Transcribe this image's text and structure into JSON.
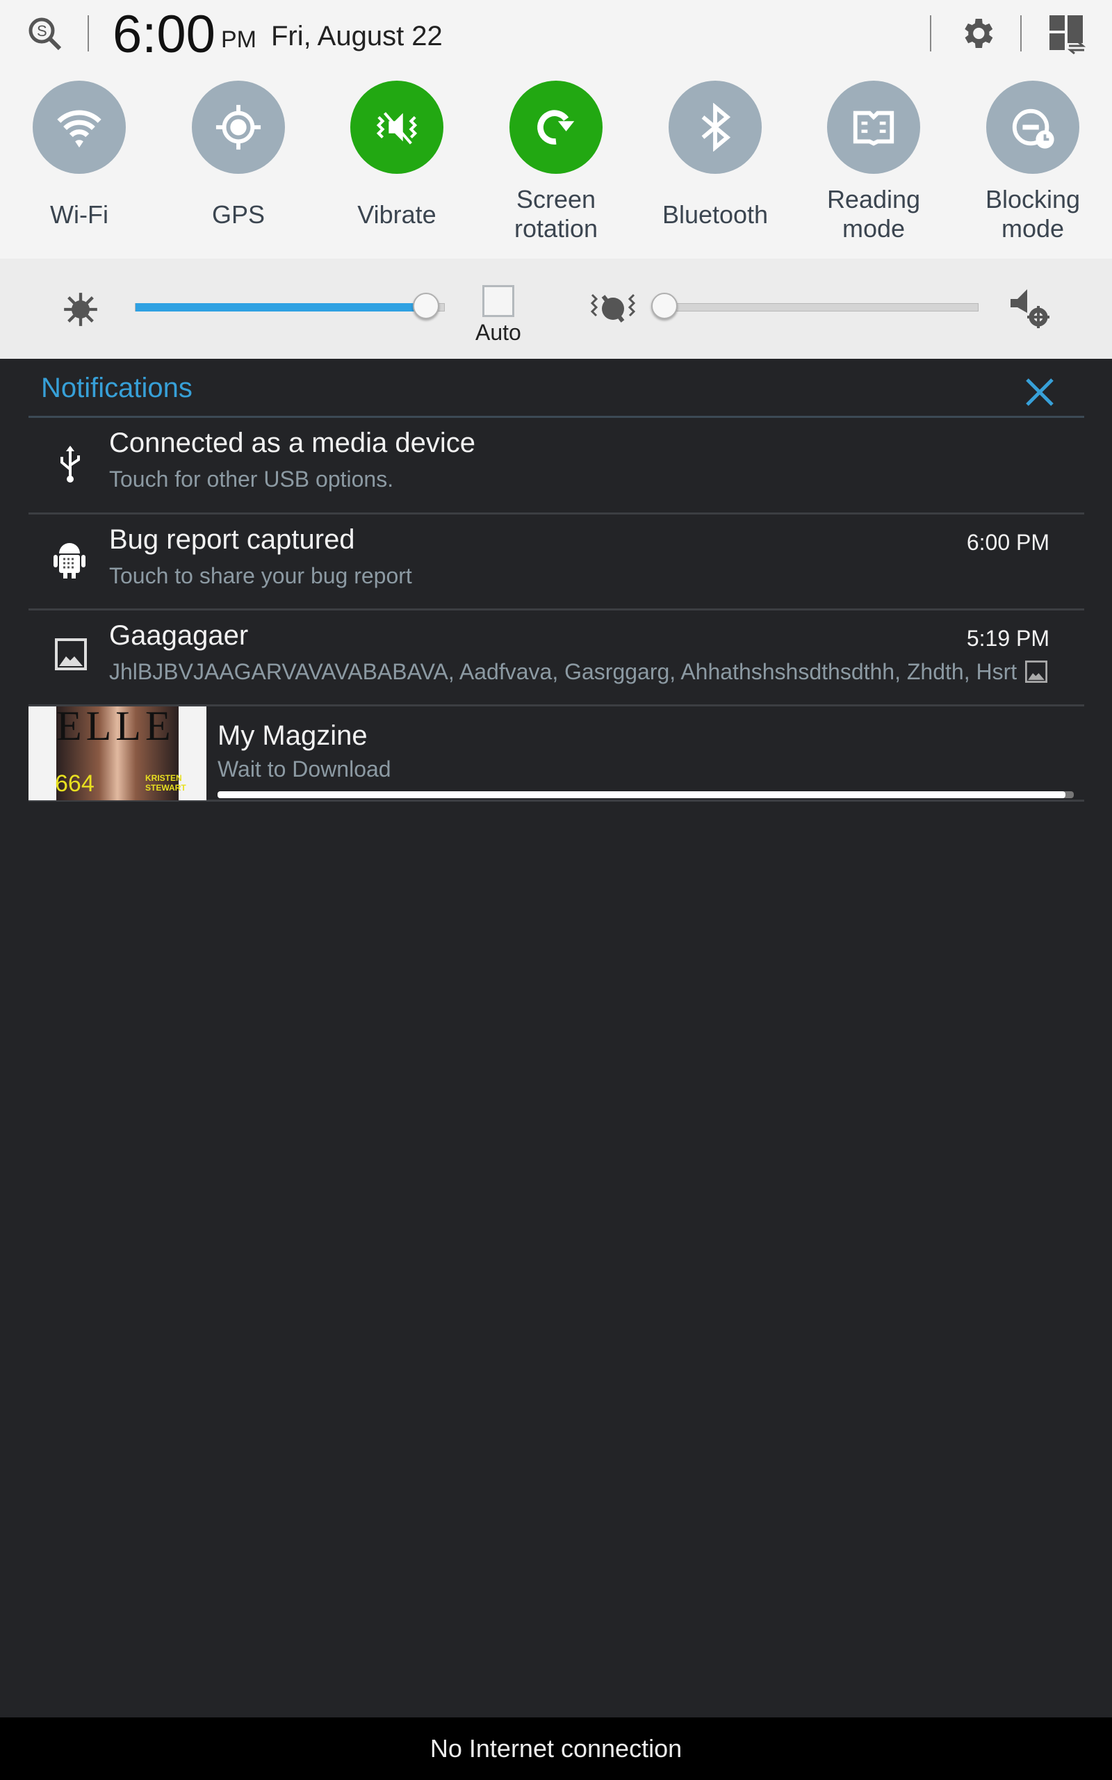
{
  "status": {
    "time": "6:00",
    "ampm": "PM",
    "date": "Fri, August 22"
  },
  "toggles": [
    {
      "label": "Wi-Fi",
      "icon": "wifi-icon",
      "on": false
    },
    {
      "label": "GPS",
      "icon": "gps-icon",
      "on": false
    },
    {
      "label": "Vibrate",
      "icon": "vibrate-icon",
      "on": true
    },
    {
      "label": "Screen rotation",
      "icon": "rotation-icon",
      "on": true
    },
    {
      "label": "Bluetooth",
      "icon": "bluetooth-icon",
      "on": false
    },
    {
      "label": "Reading mode",
      "icon": "book-icon",
      "on": false
    },
    {
      "label": "Blocking mode",
      "icon": "blocking-icon",
      "on": false
    }
  ],
  "brightness": {
    "level_percent": 94,
    "auto_label": "Auto",
    "auto_checked": false
  },
  "volume": {
    "level_percent": 0
  },
  "notifications": {
    "header": "Notifications",
    "items": [
      {
        "title": "Connected as a media device",
        "subtitle": "Touch for other USB options.",
        "time": ""
      },
      {
        "title": "Bug report captured",
        "subtitle": "Touch to share your bug report",
        "time": "6:00 PM"
      },
      {
        "title": "Gaagagaer",
        "subtitle": "JhlBJBVJAAGARVAVAVABABAVA, Aadfvava, Gasrggarg, Ahhathshshsdthsdthh, Zhdth, Hsrt",
        "time": "5:19 PM"
      },
      {
        "title": "My Magzine",
        "subtitle": "Wait to Download",
        "progress_percent": 99,
        "cover_text": "ELLE 664 KRISTEN STEWART"
      }
    ]
  },
  "bottom": {
    "text": "No Internet connection"
  },
  "colors": {
    "accent": "#37a0d8",
    "toggle_on": "#22a812",
    "toggle_off": "#9eaeba"
  }
}
